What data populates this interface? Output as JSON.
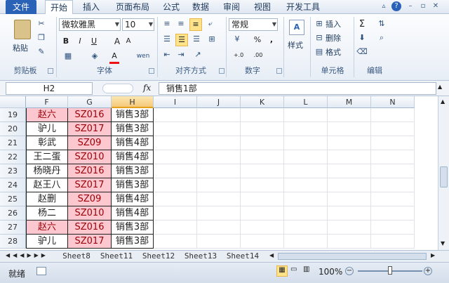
{
  "menu": {
    "tabs": [
      "文件",
      "开始",
      "插入",
      "页面布局",
      "公式",
      "数据",
      "审阅",
      "视图",
      "开发工具"
    ],
    "active_index": 1,
    "right_icons": [
      "collapse-ribbon-icon",
      "help-icon",
      "minimize-icon",
      "restore-icon",
      "close-icon"
    ]
  },
  "ribbon": {
    "clipboard": {
      "paste_label": "粘贴",
      "group_label": "剪贴板"
    },
    "font": {
      "family": "微软雅黑",
      "size": "10",
      "bold": "B",
      "italic": "I",
      "underline": "U",
      "grow": "A",
      "shrink": "A",
      "group_label": "字体",
      "phonetic": "wen"
    },
    "alignment": {
      "group_label": "对齐方式"
    },
    "number": {
      "format": "常规",
      "percent": "%",
      "comma": ",",
      "inc_decimal": "+.0",
      "dec_decimal": ".00",
      "group_label": "数字"
    },
    "styles": {
      "label": "样式"
    },
    "cells": {
      "insert": "插入",
      "delete": "删除",
      "format": "格式",
      "group_label": "单元格"
    },
    "editing": {
      "sum": "Σ",
      "group_label": "编辑"
    }
  },
  "formula_bar": {
    "name_box": "H2",
    "fx": "fx",
    "value": "销售1部"
  },
  "grid": {
    "columns": [
      "F",
      "G",
      "H",
      "I",
      "J",
      "K",
      "L",
      "M",
      "N"
    ],
    "selected_column": "H",
    "rows": [
      {
        "num": "19",
        "F": "赵六",
        "G": "SZ016",
        "H": "销售3部",
        "f_pink": true
      },
      {
        "num": "20",
        "F": "驴儿",
        "G": "SZ017",
        "H": "销售3部",
        "f_pink": false
      },
      {
        "num": "21",
        "F": "彰武",
        "G": "SZ09",
        "H": "销售4部",
        "f_pink": false
      },
      {
        "num": "22",
        "F": "王二蛋",
        "G": "SZ010",
        "H": "销售4部",
        "f_pink": false
      },
      {
        "num": "23",
        "F": "杨晓丹",
        "G": "SZ016",
        "H": "销售3部",
        "f_pink": false
      },
      {
        "num": "24",
        "F": "赵王八",
        "G": "SZ017",
        "H": "销售3部",
        "f_pink": false
      },
      {
        "num": "25",
        "F": "赵删",
        "G": "SZ09",
        "H": "销售4部",
        "f_pink": false
      },
      {
        "num": "26",
        "F": "杨二",
        "G": "SZ010",
        "H": "销售4部",
        "f_pink": false
      },
      {
        "num": "27",
        "F": "赵六",
        "G": "SZ016",
        "H": "销售3部",
        "f_pink": true
      },
      {
        "num": "28",
        "F": "驴儿",
        "G": "SZ017",
        "H": "销售3部",
        "f_pink": false
      }
    ]
  },
  "sheet_tabs": [
    "Sheet8",
    "Sheet11",
    "Sheet12",
    "Sheet13",
    "Sheet14"
  ],
  "status": {
    "ready": "就绪",
    "zoom": "100%",
    "zoom_level": 1.0
  },
  "colors": {
    "pink_fill": "#fcc7cf",
    "pink_text": "#9c0006",
    "accent": "#2a62b8"
  }
}
